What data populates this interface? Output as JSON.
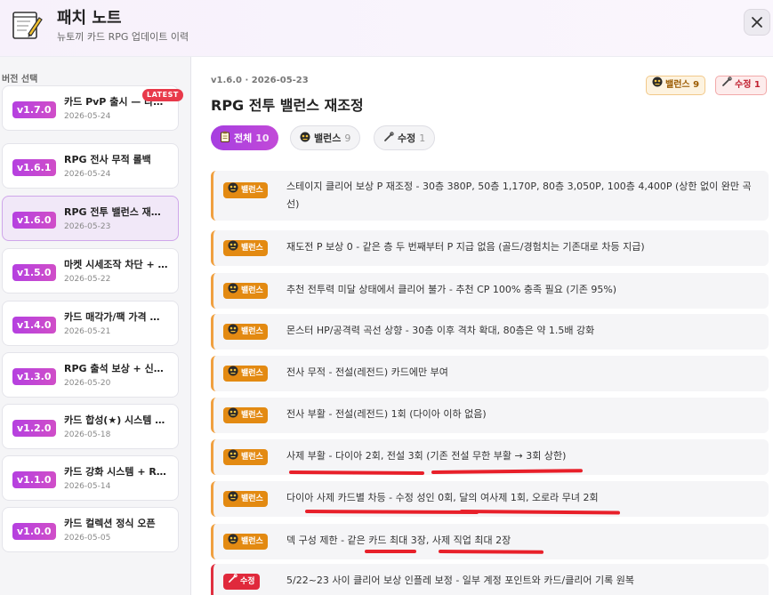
{
  "header": {
    "title": "패치 노트",
    "subtitle": "뉴토끼 카드 RPG 업데이트 이력"
  },
  "sidebar": {
    "heading": "버전 선택",
    "latest_label": "LATEST",
    "items": [
      {
        "version": "v1.7.0",
        "title": "카드 PvP 출시 — 다…",
        "date": "2026-05-24"
      },
      {
        "version": "v1.6.1",
        "title": "RPG 전사 무적 롤백",
        "date": "2026-05-24"
      },
      {
        "version": "v1.6.0",
        "title": "RPG 전투 밸런스 재…",
        "date": "2026-05-23"
      },
      {
        "version": "v1.5.0",
        "title": "마켓 시세조작 차단 + …",
        "date": "2026-05-22"
      },
      {
        "version": "v1.4.0",
        "title": "카드 매각가/팩 가격 …",
        "date": "2026-05-21"
      },
      {
        "version": "v1.3.0",
        "title": "RPG 출석 보상 + 신…",
        "date": "2026-05-20"
      },
      {
        "version": "v1.2.0",
        "title": "카드 합성(★) 시스템 …",
        "date": "2026-05-18"
      },
      {
        "version": "v1.1.0",
        "title": "카드 강화 시스템 + R…",
        "date": "2026-05-14"
      },
      {
        "version": "v1.0.0",
        "title": "카드 컬렉션 정식 오픈",
        "date": "2026-05-05"
      }
    ]
  },
  "main": {
    "meta": "v1.6.0 · 2026-05-23",
    "title": "RPG 전투 밸런스 재조정",
    "badges": {
      "balance": "밸런스 9",
      "fix": "수정 1"
    },
    "tabs": [
      {
        "label": "전체",
        "count": "10"
      },
      {
        "label": "밸런스",
        "count": "9"
      },
      {
        "label": "수정",
        "count": "1"
      }
    ],
    "tag_labels": {
      "balance": "밸런스",
      "fix": "수정"
    },
    "entries": [
      {
        "type": "balance",
        "text": "스테이지 클리어 보상 P 재조정 - 30층 380P, 50층 1,170P, 80층 3,050P, 100층 4,400P (상한 없이 완만 곡선)"
      },
      {
        "type": "balance",
        "text": "재도전 P 보상 0 - 같은 층 두 번째부터 P 지급 없음 (골드/경험치는 기존대로 차등 지급)"
      },
      {
        "type": "balance",
        "text": "추천 전투력 미달 상태에서 클리어 불가 - 추천 CP 100% 충족 필요 (기존 95%)"
      },
      {
        "type": "balance",
        "text": "몬스터 HP/공격력 곡선 상향 - 30층 이후 격차 확대, 80층은 약 1.5배 강화"
      },
      {
        "type": "balance",
        "text": "전사 무적 - 전설(레전드) 카드에만 부여"
      },
      {
        "type": "balance",
        "text": "전사 부활 - 전설(레전드) 1회 (다이아 이하 없음)"
      },
      {
        "type": "balance",
        "text": "사제 부활 - 다이아 2회, 전설 3회 (기존 전설 무한 부활 → 3회 상한)"
      },
      {
        "type": "balance",
        "text": "다이아 사제 카드별 차등 - 수정 성인 0회, 달의 여사제 1회, 오로라 무녀 2회"
      },
      {
        "type": "balance",
        "text": "덱 구성 제한 - 같은 카드 최대 3장, 사제 직업 최대 2장"
      },
      {
        "type": "fix",
        "text": "5/22~23 사이 클리어 보상 인플레 보정 - 일부 계정 포인트와 카드/클리어 기록 원복"
      }
    ]
  }
}
